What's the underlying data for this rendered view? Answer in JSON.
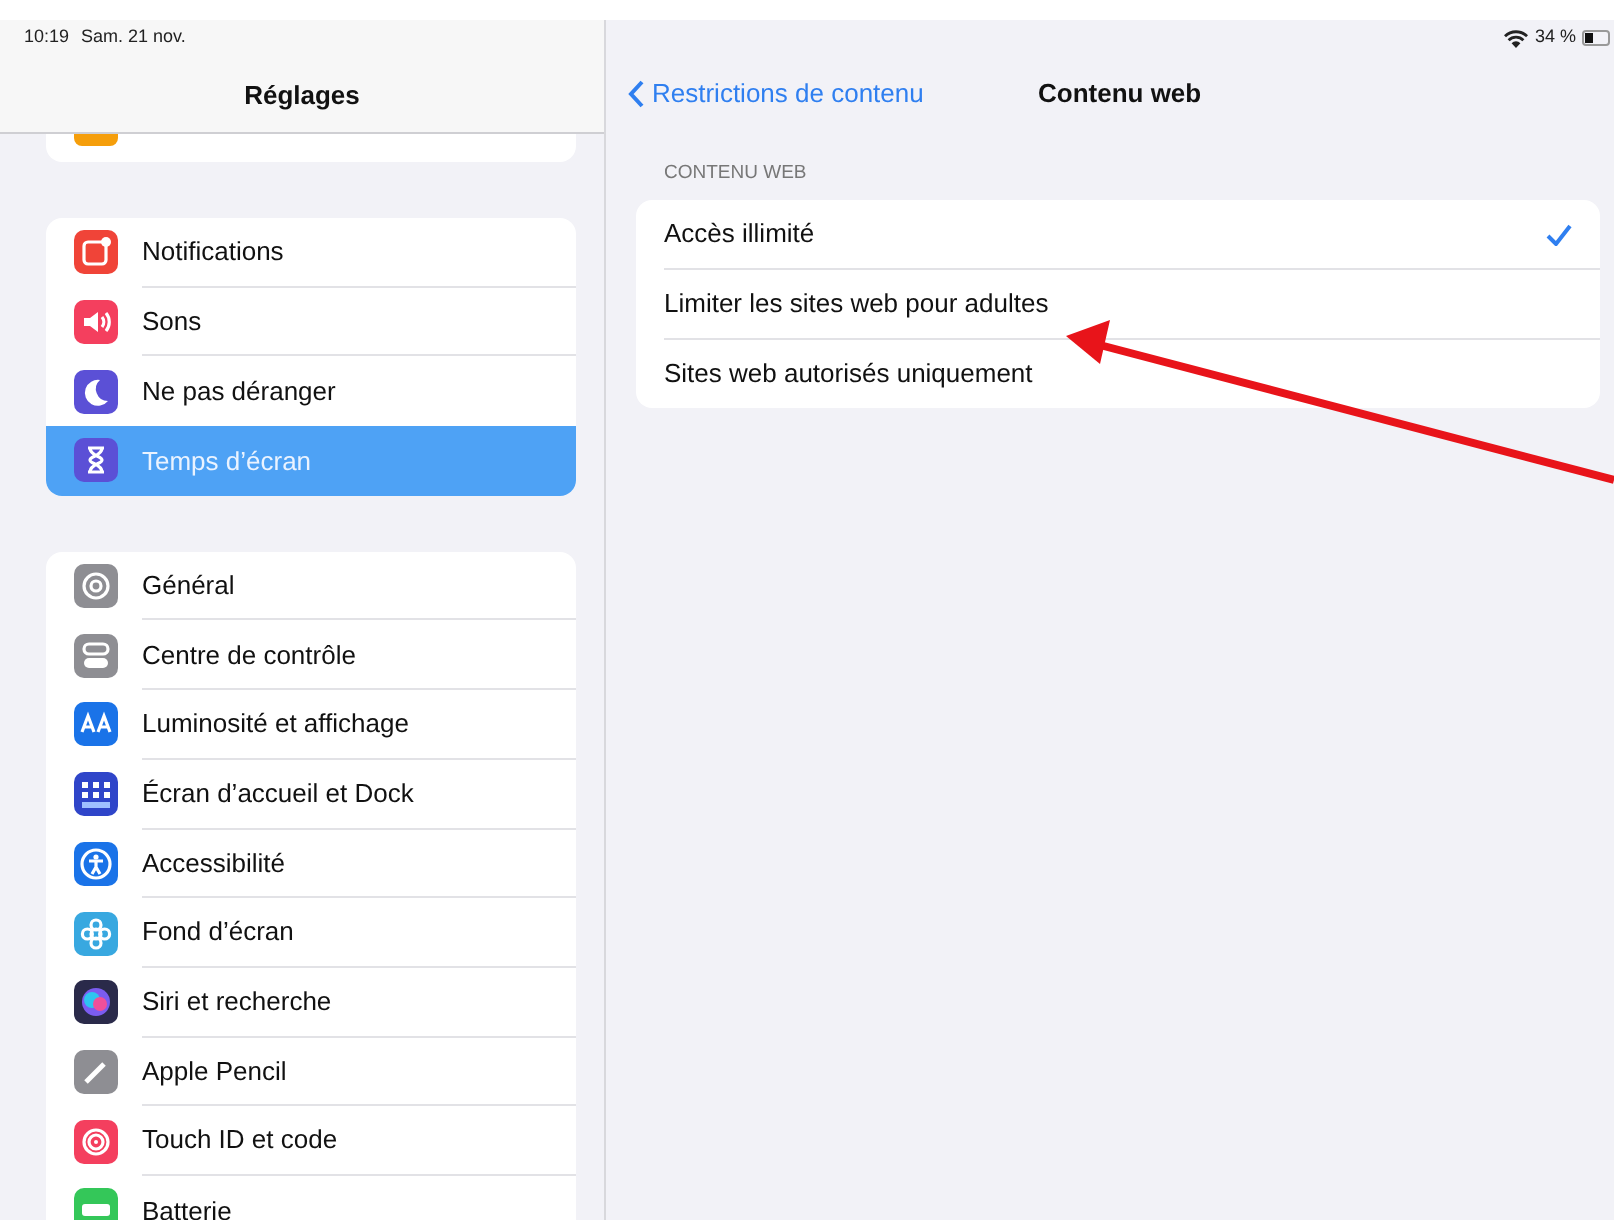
{
  "status_bar": {
    "time": "10:19",
    "date": "Sam. 21 nov.",
    "battery": "34 %"
  },
  "sidebar": {
    "title": "Réglages",
    "groups": [
      {
        "items": [
          {
            "label": "Notifications",
            "kind": "bell",
            "color": "#f04438",
            "selected": false
          },
          {
            "label": "Sons",
            "kind": "speaker",
            "color": "#f43f5e",
            "selected": false
          },
          {
            "label": "Ne pas déranger",
            "kind": "moon",
            "color": "#5b50d6",
            "selected": false
          },
          {
            "label": "Temps d’écran",
            "kind": "hourglass",
            "color": "#5b50d6",
            "selected": true
          }
        ]
      },
      {
        "items": [
          {
            "label": "Général",
            "kind": "gear",
            "color": "#8e8e93",
            "selected": false
          },
          {
            "label": "Centre de contrôle",
            "kind": "toggles",
            "color": "#8e8e93",
            "selected": false
          },
          {
            "label": "Luminosité et affichage",
            "kind": "text",
            "color": "#1a73e8",
            "selected": false
          },
          {
            "label": "Écran d’accueil et Dock",
            "kind": "grid",
            "color": "#2f45c9",
            "selected": false
          },
          {
            "label": "Accessibilité",
            "kind": "person",
            "color": "#1a73e8",
            "selected": false
          },
          {
            "label": "Fond d’écran",
            "kind": "flower",
            "color": "#38a8e0",
            "selected": false
          },
          {
            "label": "Siri et recherche",
            "kind": "orb",
            "color": "#2a2a4a",
            "selected": false
          },
          {
            "label": "Apple Pencil",
            "kind": "pencil",
            "color": "#8e8e93",
            "selected": false
          },
          {
            "label": "Touch ID et code",
            "kind": "fingerprint",
            "color": "#f43f5e",
            "selected": false
          },
          {
            "label": "Batterie",
            "kind": "battery",
            "color": "#34c759",
            "selected": false
          }
        ]
      }
    ]
  },
  "detail": {
    "back": "Restrictions de contenu",
    "title": "Contenu web",
    "section": "CONTENU WEB",
    "options": [
      {
        "label": "Accès illimité",
        "checked": true
      },
      {
        "label": "Limiter les sites web pour adultes",
        "checked": false
      },
      {
        "label": "Sites web autorisés uniquement",
        "checked": false
      }
    ]
  }
}
